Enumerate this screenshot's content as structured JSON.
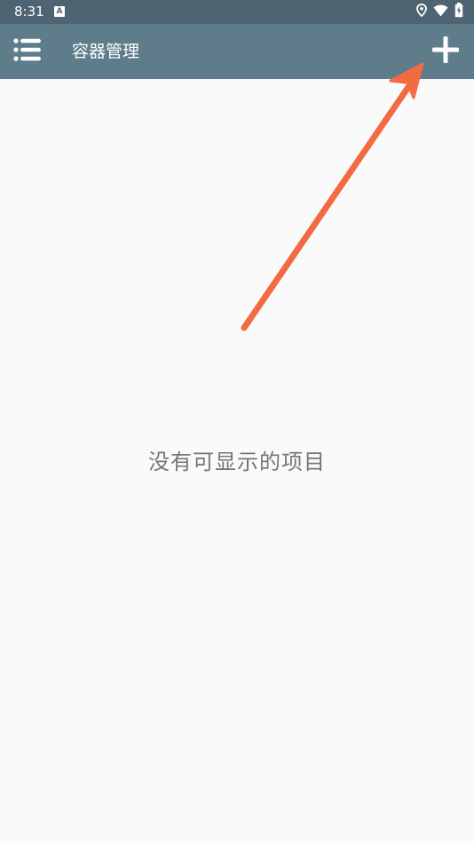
{
  "status_bar": {
    "time": "8:31",
    "notification_icon": "a-notification-icon",
    "icons": [
      "location-icon",
      "wifi-icon",
      "battery-charging-icon"
    ]
  },
  "toolbar": {
    "title": "容器管理",
    "menu_icon": "list-menu-icon",
    "add_icon": "plus-icon",
    "background_color": "#5f7c8a"
  },
  "main": {
    "empty_message": "没有可显示的项目"
  },
  "annotation": {
    "type": "arrow",
    "color": "#f26b43",
    "points_to": "add-button"
  }
}
